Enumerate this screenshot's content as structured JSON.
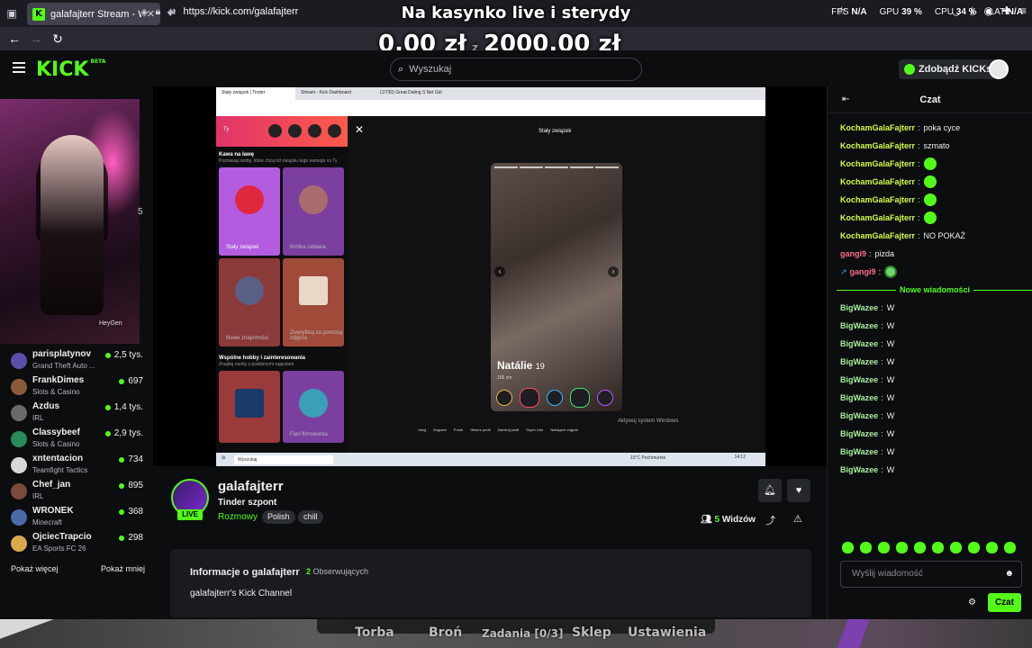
{
  "browser": {
    "tab_title": "galafajterr Stream - Watch Live",
    "url": "https://kick.com/galafajterr"
  },
  "overlay": {
    "title": "Na kasynko live i sterydy",
    "money_left": "0,00 zł",
    "money_sep": "z",
    "money_right": "2000,00 zł",
    "stats": {
      "fps_label": "FPS",
      "fps_value": "N/A",
      "gpu_label": "GPU",
      "gpu_value": "39 %",
      "cpu_label": "CPU",
      "cpu_value": "34 %",
      "lat_label": "LAT",
      "lat_value": "N/A"
    }
  },
  "header": {
    "logo": "KICK",
    "logo_badge": "BETA",
    "search_placeholder": "Wyszukaj",
    "get_kicks": "Zdobądź KICKs"
  },
  "sidebar": {
    "webcam_watermark": "HeyGen",
    "webcam_edge_number": "5",
    "channels": [
      {
        "name": "parisplatynov",
        "category": "Grand Theft Auto ...",
        "viewers": "2,5 tys.",
        "color": "#5a4fa8"
      },
      {
        "name": "FrankDimes",
        "category": "Slots & Casino",
        "viewers": "697",
        "color": "#8a5a3a"
      },
      {
        "name": "Azdus",
        "category": "IRL",
        "viewers": "1,4 tys.",
        "color": "#6a6a6a"
      },
      {
        "name": "Classybeef",
        "category": "Slots & Casino",
        "viewers": "2,9 tys.",
        "color": "#2a8a5a"
      },
      {
        "name": "xntentacion",
        "category": "Teamfight Tactics",
        "viewers": "734",
        "color": "#d8d8d8"
      },
      {
        "name": "Chef_jan",
        "category": "IRL",
        "viewers": "895",
        "color": "#7a4a3a"
      },
      {
        "name": "WRONEK",
        "category": "Minecraft",
        "viewers": "368",
        "color": "#4a6aa8"
      },
      {
        "name": "OjciecTrapcio",
        "category": "EA Sports FC 26",
        "viewers": "298",
        "color": "#d8a84a"
      }
    ],
    "show_more": "Pokaż więcej",
    "show_less": "Pokaż mniej"
  },
  "stream": {
    "tabs": [
      "Stały związek | Tinder",
      "Stream - Kick Dashboard",
      "(1/730) Great Dating S Net Girl"
    ],
    "page_title": "Stały związek",
    "left_user": "Ty",
    "section1_title": "Kawa na ławę",
    "section1_sub": "Poznawaj osoby, które chcą od związku tego samego co Ty",
    "cards": [
      "Stały związek",
      "Krótka zabawa",
      "Nowe znajomości",
      "Zweryfikuj za pomocą zdjęcia"
    ],
    "section2_title": "Wspólne hobby i zainteresowania",
    "section2_sub": "Znajduj osoby z podobnymi zajęciami",
    "cards2": [
      "",
      "Fani filmowania"
    ],
    "profile_name": "Natálie",
    "profile_age": "19",
    "profile_dist": "156 cm",
    "bottom_bar": [
      "Ukryj",
      "Zegnam",
      "Polub",
      "Otwórz profil",
      "Zamknij profil",
      "Super Like",
      "Następne zdjęcie"
    ],
    "activate_windows": "Aktywuj system Windows",
    "taskbar_search": "Wyszukaj",
    "taskbar_weather": "15°C Pochmurnie",
    "taskbar_clock": "14:12"
  },
  "channel": {
    "name": "galafajterr",
    "live": "LIVE",
    "title": "Tinder szpont",
    "category": "Rozmowy",
    "tags": [
      "Polish",
      "chill"
    ],
    "viewers_count": "5",
    "viewers_label": "Widzów",
    "about_title": "Informacje o galafajterr",
    "followers_count": "2",
    "followers_label": "Obserwujących",
    "description": "galafajterr's Kick Channel"
  },
  "chat": {
    "title": "Czat",
    "messages_before": [
      {
        "user": "KochamGalaFajterr",
        "text": "poka cyce",
        "color": "#d4ff49",
        "emote": false
      },
      {
        "user": "KochamGalaFajterr",
        "text": "szmato",
        "color": "#d4ff49",
        "emote": false
      },
      {
        "user": "KochamGalaFajterr",
        "text": "",
        "color": "#d4ff49",
        "emote": true
      },
      {
        "user": "KochamGalaFajterr",
        "text": "",
        "color": "#d4ff49",
        "emote": true
      },
      {
        "user": "KochamGalaFajterr",
        "text": "",
        "color": "#d4ff49",
        "emote": true
      },
      {
        "user": "KochamGalaFajterr",
        "text": "",
        "color": "#d4ff49",
        "emote": true
      },
      {
        "user": "KochamGalaFajterr",
        "text": "NO POKAŻ",
        "color": "#d4ff49",
        "emote": false
      },
      {
        "user": "gangi9",
        "text": "pizda",
        "color": "#ff6b8b",
        "emote": false
      },
      {
        "user": "gangi9",
        "text": "",
        "color": "#ff6b8b",
        "emote": true,
        "owl": true
      }
    ],
    "divider": "Nowe wiadomości",
    "messages_after_user": "BigWazee",
    "messages_after_text": "W",
    "messages_after_count": 10,
    "input_placeholder": "Wyślij wiadomość",
    "send": "Czat",
    "accent": "#53fc18"
  },
  "game_menu": [
    "Torba",
    "Broń",
    "Zadania [0/3]",
    "Sklep",
    "Ustawienia"
  ]
}
